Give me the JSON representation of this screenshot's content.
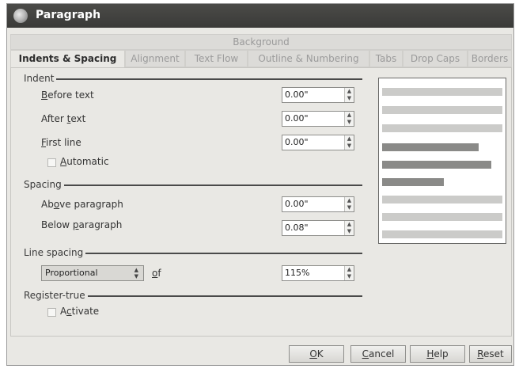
{
  "title": "Paragraph",
  "tabs_top": [
    "Background"
  ],
  "tabs": [
    "Indents & Spacing",
    "Alignment",
    "Text Flow",
    "Outline & Numbering",
    "Tabs",
    "Drop Caps",
    "Borders"
  ],
  "indent": {
    "section": "Indent",
    "before_text": {
      "label": "Before text",
      "value": "0.00\""
    },
    "after_text": {
      "label": "After text",
      "value": "0.00\""
    },
    "first_line": {
      "label": "First line",
      "value": "0.00\""
    },
    "automatic": "Automatic"
  },
  "spacing": {
    "section": "Spacing",
    "above": {
      "label": "Above paragraph",
      "value": "0.00\""
    },
    "below": {
      "label": "Below paragraph",
      "value": "0.08\""
    }
  },
  "line_spacing": {
    "section": "Line spacing",
    "mode": "Proportional",
    "of_label": "of",
    "value": "115%"
  },
  "register_true": {
    "section": "Register-true",
    "activate": "Activate"
  },
  "buttons": {
    "ok": "OK",
    "cancel": "Cancel",
    "help": "Help",
    "reset": "Reset"
  }
}
